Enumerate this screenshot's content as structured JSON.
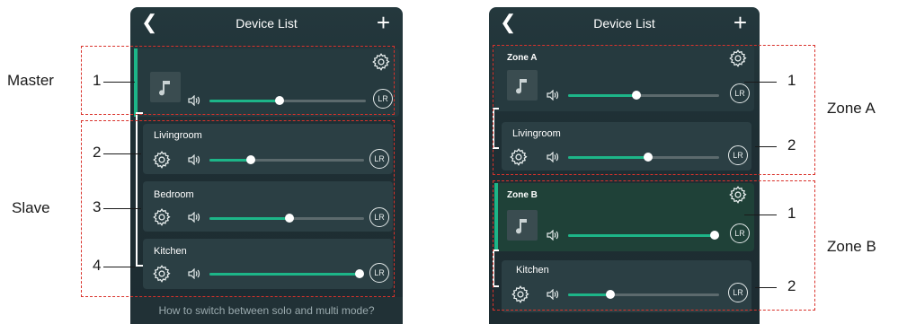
{
  "left_phone": {
    "title": "Device List",
    "devices": [
      {
        "name": "",
        "volume": 0.45
      },
      {
        "name": "Livingroom",
        "volume": 0.27
      },
      {
        "name": "Bedroom",
        "volume": 0.52
      },
      {
        "name": "Kitchen",
        "volume": 0.97
      }
    ],
    "footer": "How to switch between solo and multi mode?"
  },
  "right_phone": {
    "title": "Device List",
    "zones": [
      {
        "label": "Zone A",
        "devices": [
          {
            "name": "Zone A",
            "volume": 0.45
          },
          {
            "name": "Livingroom",
            "volume": 0.53
          }
        ]
      },
      {
        "label": "Zone B",
        "devices": [
          {
            "name": "Zone B",
            "volume": 0.97
          },
          {
            "name": "Kitchen",
            "volume": 0.28
          }
        ]
      }
    ]
  },
  "lr_label": "LR",
  "annotations": {
    "master": "Master",
    "slave": "Slave",
    "zone_a": "Zone A",
    "zone_b": "Zone B",
    "n1": "1",
    "n2": "2",
    "n3": "3",
    "n4": "4"
  },
  "colors": {
    "accent": "#1db588",
    "annotation_dash": "#d9322b"
  }
}
